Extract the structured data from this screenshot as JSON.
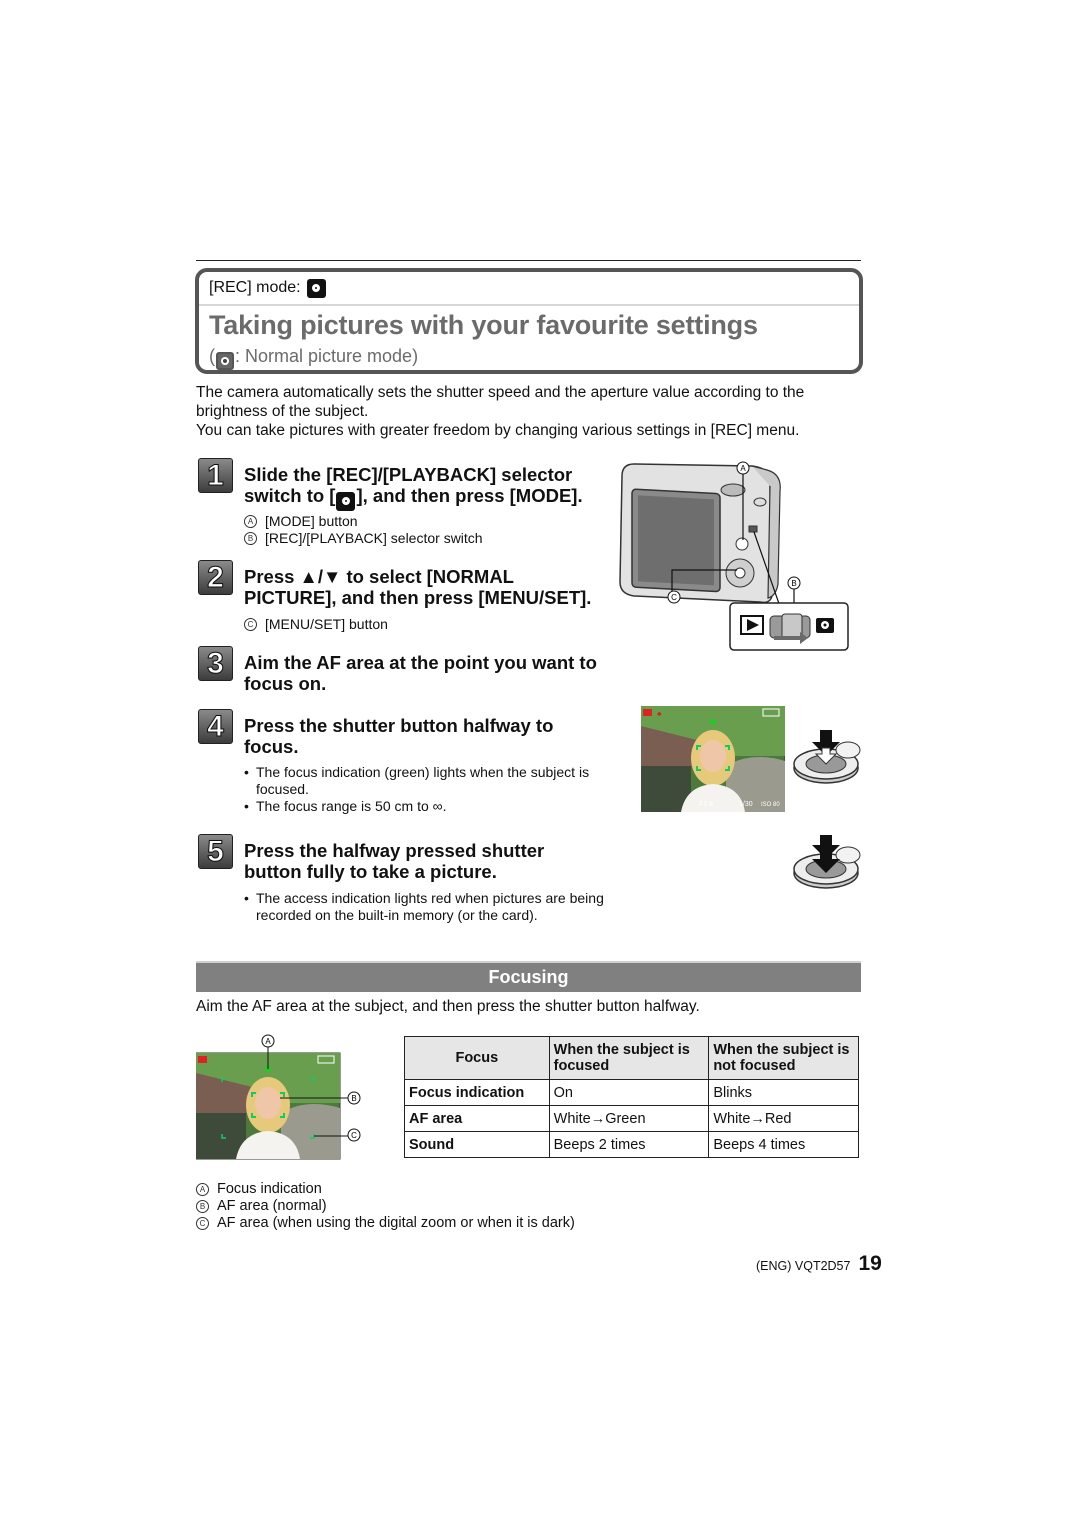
{
  "header": {
    "rec_mode_label": "[REC] mode:",
    "rec_mode_icon": "camera-normal-icon",
    "title": "Taking pictures with your favourite settings",
    "subtitle_prefix": "(",
    "subtitle_text": ": Normal picture mode)"
  },
  "intro": {
    "para1": "The camera automatically sets the shutter speed and the aperture value according to the brightness of the subject.",
    "para2": "You can take pictures with greater freedom by changing various settings in [REC] menu."
  },
  "steps": [
    {
      "number": "1",
      "title_line1": "Slide the [REC]/[PLAYBACK] selector",
      "title_line2_pre": "switch to [",
      "title_line2_post": "], and then press [MODE].",
      "notes": [
        {
          "marker": "A",
          "text": "[MODE] button"
        },
        {
          "marker": "B",
          "text": "[REC]/[PLAYBACK] selector switch"
        }
      ]
    },
    {
      "number": "2",
      "title_line1": "Press ▲/▼ to select [NORMAL",
      "title_line2": "PICTURE], and then press [MENU/SET].",
      "notes": [
        {
          "marker": "C",
          "text": "[MENU/SET] button"
        }
      ]
    },
    {
      "number": "3",
      "title_line1": "Aim the AF area at the point you want to",
      "title_line2": "focus on."
    },
    {
      "number": "4",
      "title_line1": "Press the shutter button halfway to",
      "title_line2": "focus.",
      "bullets": [
        "The focus indication (green) lights when the subject is focused.",
        "The focus range is 50 cm to ∞."
      ]
    },
    {
      "number": "5",
      "title_line1": "Press the halfway pressed shutter",
      "title_line2": "button fully to take a picture.",
      "bullets": [
        "The access indication lights red when pictures are being recorded on the built-in memory (or the card)."
      ]
    }
  ],
  "illustrations": {
    "camera_markers": [
      "A",
      "B",
      "C"
    ],
    "photo_overlay": {
      "aperture": "F2.8",
      "shutter": "1/30",
      "iso": "ISO 80",
      "range": "0.5m - ∞"
    }
  },
  "focusing": {
    "heading": "Focusing",
    "description": "Aim the AF area at the subject, and then press the shutter button halfway.",
    "table": {
      "headers": [
        "Focus",
        "When the subject is focused",
        "When the subject is not focused"
      ],
      "rows": [
        [
          "Focus indication",
          "On",
          "Blinks"
        ],
        [
          "AF area",
          "White→Green",
          "White→Red"
        ],
        [
          "Sound",
          "Beeps 2 times",
          "Beeps 4 times"
        ]
      ]
    },
    "legend": [
      {
        "marker": "A",
        "text": "Focus indication"
      },
      {
        "marker": "B",
        "text": "AF area (normal)"
      },
      {
        "marker": "C",
        "text": "AF area (when using the digital zoom or when it is dark)"
      }
    ]
  },
  "footer": {
    "code": "(ENG) VQT2D57",
    "page": "19"
  }
}
